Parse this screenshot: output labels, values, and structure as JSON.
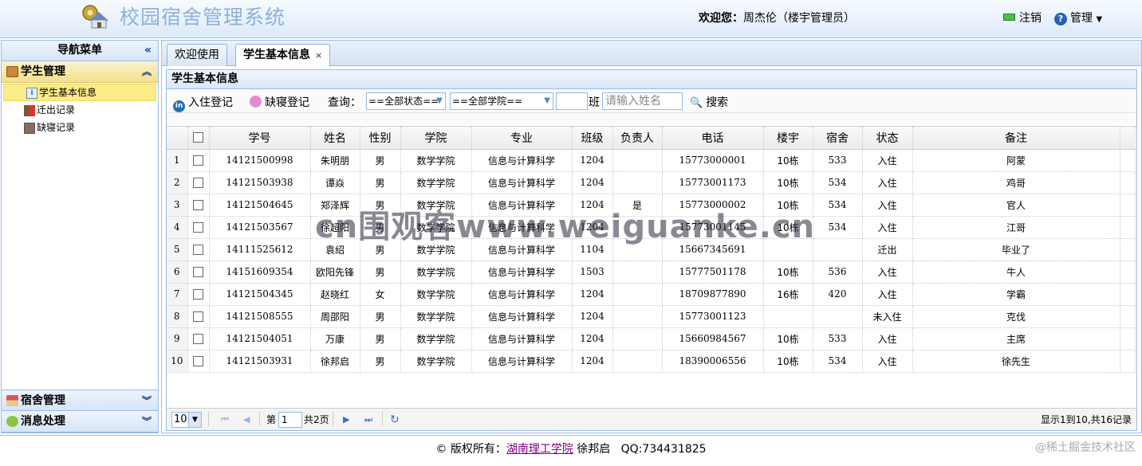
{
  "header": {
    "app_title": "校园宿舍管理系统",
    "welcome_label": "欢迎您：",
    "welcome_user": "周杰伦（楼宇管理员）",
    "logout_label": "注销",
    "manage_label": "管理"
  },
  "sidebar": {
    "title": "导航菜单",
    "groups": [
      {
        "label": "学生管理",
        "items": [
          {
            "label": "学生基本信息"
          },
          {
            "label": "迁出记录"
          },
          {
            "label": "缺寝记录"
          }
        ]
      },
      {
        "label": "宿舍管理"
      },
      {
        "label": "消息处理"
      }
    ]
  },
  "tabs": [
    {
      "label": "欢迎使用"
    },
    {
      "label": "学生基本信息",
      "close": "×"
    }
  ],
  "panel": {
    "title": "学生基本信息"
  },
  "toolbar": {
    "checkin_label": "入住登记",
    "absence_label": "缺寝登记",
    "query_label": "查询：",
    "status_select": "==全部状态==",
    "college_select": "==全部学院==",
    "class_value": "",
    "class_suffix": "班",
    "name_placeholder": "请输入姓名",
    "search_label": "搜索"
  },
  "grid": {
    "columns": [
      "学号",
      "姓名",
      "性别",
      "学院",
      "专业",
      "班级",
      "负责人",
      "电话",
      "楼宇",
      "宿舍",
      "状态",
      "备注"
    ],
    "rows": [
      [
        "14121500998",
        "朱明朋",
        "男",
        "数学学院",
        "信息与计算科学",
        "1204",
        "",
        "15773000001",
        "10栋",
        "533",
        "入住",
        "阿蒙"
      ],
      [
        "14121503938",
        "谭焱",
        "男",
        "数学学院",
        "信息与计算科学",
        "1204",
        "",
        "15773001173",
        "10栋",
        "534",
        "入住",
        "鸡哥"
      ],
      [
        "14121504645",
        "郑泽辉",
        "男",
        "数学学院",
        "信息与计算科学",
        "1204",
        "是",
        "15773000002",
        "10栋",
        "534",
        "入住",
        "官人"
      ],
      [
        "14121503567",
        "徐超阳",
        "男",
        "数学学院",
        "信息与计算科学",
        "1204",
        "",
        "15773001145",
        "10栋",
        "534",
        "入住",
        "江哥"
      ],
      [
        "14111525612",
        "袁绍",
        "男",
        "数学学院",
        "信息与计算科学",
        "1104",
        "",
        "15667345691",
        "",
        "",
        "迁出",
        "毕业了"
      ],
      [
        "14151609354",
        "欧阳先锋",
        "男",
        "数学学院",
        "信息与计算科学",
        "1503",
        "",
        "15777501178",
        "10栋",
        "536",
        "入住",
        "牛人"
      ],
      [
        "14121504345",
        "赵晓红",
        "女",
        "数学学院",
        "信息与计算科学",
        "1204",
        "",
        "18709877890",
        "16栋",
        "420",
        "入住",
        "学霸"
      ],
      [
        "14121508555",
        "周邵阳",
        "男",
        "数学学院",
        "信息与计算科学",
        "1204",
        "",
        "15773001123",
        "",
        "",
        "未入住",
        "克伐"
      ],
      [
        "14121504051",
        "万康",
        "男",
        "数学学院",
        "信息与计算科学",
        "1204",
        "",
        "15660984567",
        "10栋",
        "533",
        "入住",
        "主席"
      ],
      [
        "14121503931",
        "徐邦启",
        "男",
        "数学学院",
        "信息与计算科学",
        "1204",
        "",
        "18390006556",
        "10栋",
        "534",
        "入住",
        "徐先生"
      ]
    ]
  },
  "pager": {
    "page_size": "10",
    "page_prefix": "第",
    "page_value": "1",
    "page_total": "共2页",
    "info": "显示1到10,共16记录"
  },
  "watermark": "cn围观客www.weiguanke.cn",
  "footer": {
    "prefix": "© 版权所有：",
    "link": "湖南理工学院",
    "suffix": " 徐邦启   QQ:734431825",
    "corner": "@稀土掘金技术社区"
  },
  "colors": {
    "accent": "#99bbe8",
    "active_menu": "#fbec88",
    "title_blue": "#8eb1d8"
  }
}
